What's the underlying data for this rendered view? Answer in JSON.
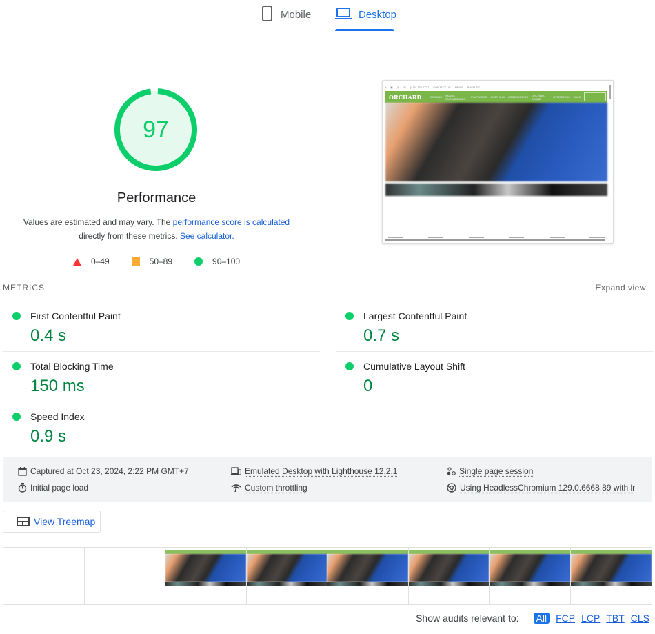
{
  "tabs": [
    {
      "label": "Mobile",
      "icon": "smartphone-icon",
      "active": false
    },
    {
      "label": "Desktop",
      "icon": "laptop-icon",
      "active": true
    }
  ],
  "score": {
    "value": "97",
    "fraction": 0.97,
    "title": "Performance",
    "color": "#0cce6b"
  },
  "description": {
    "prefix": "Values are estimated and may vary. The ",
    "link1": "performance score is calculated",
    "middle": " directly from these metrics. ",
    "link2": "See calculator."
  },
  "legend": [
    {
      "range": "0–49",
      "shape": "triangle",
      "color": "#ff3333"
    },
    {
      "range": "50–89",
      "shape": "square",
      "color": "#ffaa33"
    },
    {
      "range": "90–100",
      "shape": "circle",
      "color": "#0cce6b"
    }
  ],
  "screenshot": {
    "logo": "ORCHARD",
    "topbar": [
      "f",
      "▣",
      "◎",
      "✉",
      "(415) 752-7777",
      "CONTACT US",
      "NEWS",
      "RAFFLES"
    ],
    "nav": [
      "BRANDS",
      "SKATE-SNOWBOARDS",
      "FOOTWEAR",
      "CLOTHING",
      "ACCESSORIES",
      "ORCHARD BRAND",
      "OVERSTOCK",
      "SALE"
    ]
  },
  "metrics": {
    "header": "METRICS",
    "expand_label": "Expand view",
    "items": [
      {
        "label": "First Contentful Paint",
        "value": "0.4 s"
      },
      {
        "label": "Largest Contentful Paint",
        "value": "0.7 s"
      },
      {
        "label": "Total Blocking Time",
        "value": "150 ms"
      },
      {
        "label": "Cumulative Layout Shift",
        "value": "0"
      },
      {
        "label": "Speed Index",
        "value": "0.9 s"
      }
    ]
  },
  "runtime": {
    "captured": "Captured at Oct 23, 2024, 2:22 PM GMT+7",
    "load": "Initial page load",
    "emulated": "Emulated Desktop with Lighthouse 12.2.1",
    "throttling": "Custom throttling",
    "session": "Single page session",
    "browser": "Using HeadlessChromium 129.0.6668.89 with lr"
  },
  "treemap": {
    "label": "View Treemap"
  },
  "filmstrip": {
    "frame_count": 8,
    "blank_frames": 2
  },
  "audit_filter": {
    "label": "Show audits relevant to:",
    "options": [
      "All",
      "FCP",
      "LCP",
      "TBT",
      "CLS"
    ],
    "active": "All"
  }
}
